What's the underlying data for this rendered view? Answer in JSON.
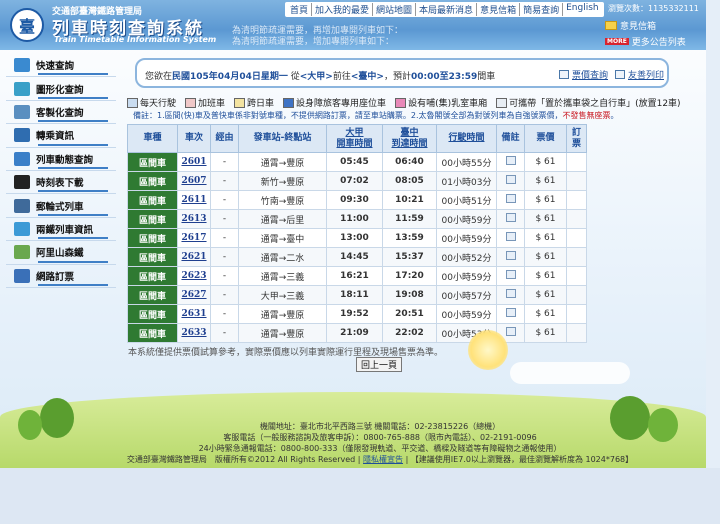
{
  "header": {
    "org_name": "交通部臺灣鐵路管理局",
    "title": "列車時刻查詢系統",
    "subtitle": "Train Timetable Information System",
    "marquee_line1": "為清明節疏運需要，再增加專開列車如下：",
    "marquee_line2": "為清明節疏運需要，增加專開列車如下：",
    "nav": [
      "首頁",
      "加入我的最愛",
      "網站地圖",
      "本局最新消息",
      "意見信箱",
      "簡易查詢",
      "English"
    ],
    "visit_count": "瀏覽次數：1135332111",
    "opinion_label": "意見信箱",
    "more_badge": "MORE",
    "more_label": "更多公告列表"
  },
  "sidebar": {
    "items": [
      {
        "label": "快速查詢",
        "color": "#3a8ad0"
      },
      {
        "label": "圖形化查詢",
        "color": "#3aa0c8"
      },
      {
        "label": "客製化查詢",
        "color": "#5a8fc0"
      },
      {
        "label": "轉乘資訊",
        "color": "#2f6db0"
      },
      {
        "label": "列車動態查詢",
        "color": "#3a7fc8"
      },
      {
        "label": "時刻表下載",
        "color": "#222222"
      },
      {
        "label": "郵輪式列車",
        "color": "#3f6a9a"
      },
      {
        "label": "兩鐵列車資訊",
        "color": "#3c9ad6"
      },
      {
        "label": "阿里山森鐵",
        "color": "#6aa84f"
      },
      {
        "label": "網路訂票",
        "color": "#3a70b8"
      }
    ]
  },
  "query": {
    "prefix": "您欲在",
    "date": "民國105年04月04日星期一",
    "from_word": "從",
    "origin": "<大甲>",
    "to_word": "前往",
    "destination": "<臺中>",
    "window_prefix": "，預計",
    "window": "00:00至23:59",
    "suffix": "間車",
    "fare_link": "票價查詢",
    "print_link": "友善列印"
  },
  "legend": [
    "每天行駛",
    "加班車",
    "跨日車",
    "設身障旅客專用座位車",
    "設有哺(集)乳室車廂",
    "可攜帶「置於攜車袋之自行車」(放置12車)"
  ],
  "note": {
    "prefix": "備註：1.區間(快)車及普快車係非對號車種，不提供網路訂票，請至車站購票。2.太魯閣號全部為對號列車為自強號票價，",
    "highlight": "不發售無座票",
    "suffix": "。"
  },
  "table": {
    "headers": {
      "type": "車種",
      "train_no": "車次",
      "via": "經由",
      "route": "發車站-終點站",
      "dep_top": "大甲",
      "dep_bottom": "開車時間",
      "arr_top": "臺中",
      "arr_bottom": "到達時間",
      "duration": "行駛時間",
      "remark": "備註",
      "fare": "票價",
      "book_top": "訂",
      "book_bottom": "票"
    },
    "rows": [
      {
        "type": "區間車",
        "train_no": "2601",
        "via": "-",
        "route": "通霄→豐原",
        "dep": "05:45",
        "arr": "06:40",
        "duration": "00小時55分",
        "fare": "$ 61"
      },
      {
        "type": "區間車",
        "train_no": "2607",
        "via": "-",
        "route": "新竹→豐原",
        "dep": "07:02",
        "arr": "08:05",
        "duration": "01小時03分",
        "fare": "$ 61"
      },
      {
        "type": "區間車",
        "train_no": "2611",
        "via": "-",
        "route": "竹南→豐原",
        "dep": "09:30",
        "arr": "10:21",
        "duration": "00小時51分",
        "fare": "$ 61"
      },
      {
        "type": "區間車",
        "train_no": "2613",
        "via": "-",
        "route": "通霄→后里",
        "dep": "11:00",
        "arr": "11:59",
        "duration": "00小時59分",
        "fare": "$ 61"
      },
      {
        "type": "區間車",
        "train_no": "2617",
        "via": "-",
        "route": "通霄→臺中",
        "dep": "13:00",
        "arr": "13:59",
        "duration": "00小時59分",
        "fare": "$ 61"
      },
      {
        "type": "區間車",
        "train_no": "2621",
        "via": "-",
        "route": "通霄→二水",
        "dep": "14:45",
        "arr": "15:37",
        "duration": "00小時52分",
        "fare": "$ 61"
      },
      {
        "type": "區間車",
        "train_no": "2623",
        "via": "-",
        "route": "通霄→三義",
        "dep": "16:21",
        "arr": "17:20",
        "duration": "00小時59分",
        "fare": "$ 61"
      },
      {
        "type": "區間車",
        "train_no": "2627",
        "via": "-",
        "route": "大甲→三義",
        "dep": "18:11",
        "arr": "19:08",
        "duration": "00小時57分",
        "fare": "$ 61"
      },
      {
        "type": "區間車",
        "train_no": "2631",
        "via": "-",
        "route": "通霄→豐原",
        "dep": "19:52",
        "arr": "20:51",
        "duration": "00小時59分",
        "fare": "$ 61"
      },
      {
        "type": "區間車",
        "train_no": "2633",
        "via": "-",
        "route": "通霄→豐原",
        "dep": "21:09",
        "arr": "22:02",
        "duration": "00小時53分",
        "fare": "$ 61"
      }
    ]
  },
  "footnote": "本系統僅提供票價試算參考，實際票價應以列車實際運行里程及現場售票為準。",
  "back_button": "回上一頁",
  "footer": {
    "address": "機關地址：臺北市北平西路三號 機關電話：02-23815226（總機）",
    "service": "客服電話（一般服務諮詢及旅客申訴）：0800-765-888（限市內電話）、02-2191-0096",
    "emergency": "24小時緊急通報電話：0800-800-333（僅限發現軌道、平交道、橋樑及隧道等有障礙物之通報使用）",
    "copyright": "交通部臺灣鐵路管理局　版權所有©2012 All Rights Reserved",
    "privacy_link": "隱私權宣告",
    "browser_note": "【建議使用IE7.0以上瀏覽器，最佳瀏覽解析度為 1024*768】"
  }
}
